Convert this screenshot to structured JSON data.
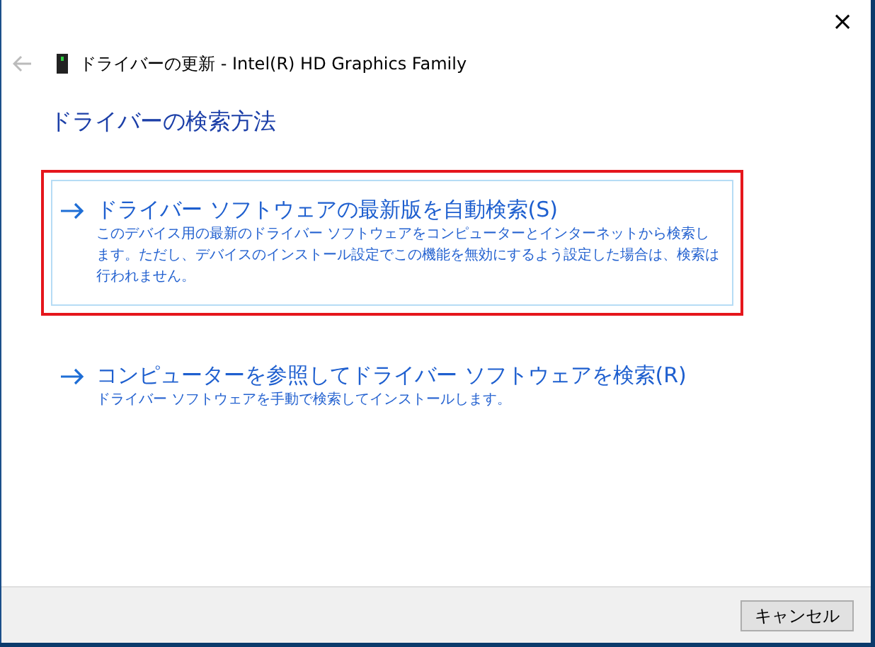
{
  "window": {
    "title": "ドライバーの更新 - Intel(R) HD Graphics Family",
    "close": "×"
  },
  "heading": "ドライバーの検索方法",
  "options": [
    {
      "title": "ドライバー ソフトウェアの最新版を自動検索(S)",
      "description": "このデバイス用の最新のドライバー ソフトウェアをコンピューターとインターネットから検索します。ただし、デバイスのインストール設定でこの機能を無効にするよう設定した場合は、検索は行われません。",
      "highlighted": true,
      "annotated": true
    },
    {
      "title": "コンピューターを参照してドライバー ソフトウェアを検索(R)",
      "description": "ドライバー ソフトウェアを手動で検索してインストールします。",
      "highlighted": false,
      "annotated": false
    }
  ],
  "buttons": [
    "キャンセル"
  ]
}
